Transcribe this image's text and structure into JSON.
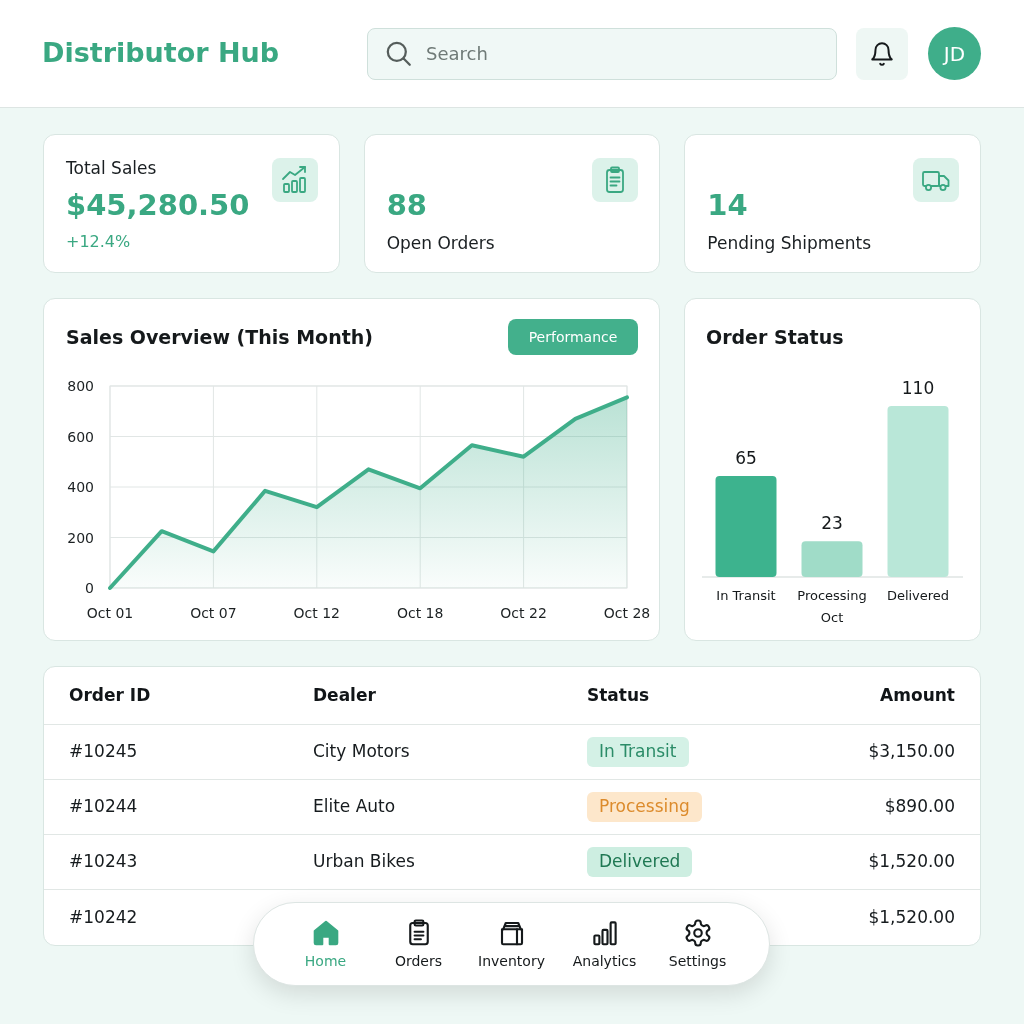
{
  "app_title": "Distributor Hub",
  "search": {
    "placeholder": "Search"
  },
  "user": {
    "initials": "JD"
  },
  "stats": [
    {
      "kind": "trend",
      "label": "Total Sales",
      "value": "$45,280.50",
      "change": "+12.4%"
    },
    {
      "kind": "count",
      "value": "88",
      "label": "Open Orders"
    },
    {
      "kind": "count",
      "value": "14",
      "label": "Pending Shipments"
    }
  ],
  "sales_overview": {
    "action": "Performance",
    "chart_data": {
      "type": "area",
      "title": "Sales Overview (This Month)",
      "categories": [
        "Oct 01",
        null,
        "Oct 07",
        null,
        "Oct 12",
        null,
        "Oct 18",
        null,
        "Oct 22",
        null,
        "Oct 28"
      ],
      "values": [
        0,
        225,
        145,
        385,
        320,
        470,
        395,
        565,
        520,
        670,
        755
      ],
      "ylim": [
        0,
        800
      ],
      "yticks": [
        0,
        200,
        400,
        600,
        800
      ],
      "grid": true
    }
  },
  "order_status": {
    "chart_data": {
      "type": "bar",
      "title": "Order Status",
      "categories": [
        "In Transit",
        "Processing\nOct",
        "Delivered"
      ],
      "values": [
        65,
        23,
        110
      ],
      "colors": [
        "#3db38e",
        "#a0dcc8",
        "#b9e7d8"
      ],
      "data_labels": true
    }
  },
  "table": {
    "columns": [
      "Order ID",
      "Dealer",
      "Status",
      "Amount"
    ],
    "rows": [
      {
        "order_id": "#10245",
        "dealer": "City Motors",
        "status": {
          "label": "In Transit",
          "kind": "transit"
        },
        "amount": "$3,150.00"
      },
      {
        "order_id": "#10244",
        "dealer": "Elite Auto",
        "status": {
          "label": "Processing",
          "kind": "processing"
        },
        "amount": "$890.00"
      },
      {
        "order_id": "#10243",
        "dealer": "Urban Bikes",
        "status": {
          "label": "Delivered",
          "kind": "delivered"
        },
        "amount": "$1,520.00"
      },
      {
        "order_id": "#10242",
        "amount": "$1,520.00"
      }
    ]
  },
  "nav": [
    {
      "label": "Home",
      "selected": true
    },
    {
      "label": "Orders",
      "selected": false
    },
    {
      "label": "Inventory",
      "selected": false
    },
    {
      "label": "Analytics",
      "selected": false
    },
    {
      "label": "Settings",
      "selected": false
    }
  ]
}
